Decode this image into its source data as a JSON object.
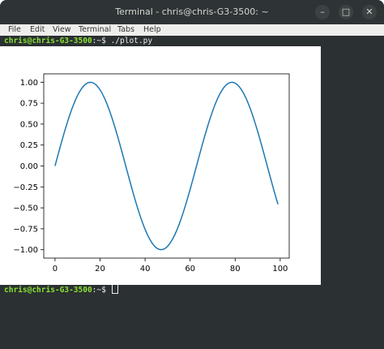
{
  "window": {
    "title": "Terminal - chris@chris-G3-3500: ~"
  },
  "menu": [
    "File",
    "Edit",
    "View",
    "Terminal",
    "Tabs",
    "Help"
  ],
  "terminal": {
    "prompt_user": "chris@chris-G3-3500",
    "prompt_suffix": ":~$ ",
    "command": "./plot.py"
  },
  "colors": {
    "line": "#1f77b4",
    "prompt": "#8ae234",
    "terminal_bg": "#2b3032"
  },
  "chart_data": {
    "type": "line",
    "x_ticks": [
      "0",
      "20",
      "40",
      "60",
      "80",
      "100"
    ],
    "y_ticks": [
      "1.00",
      "0.75",
      "0.50",
      "0.25",
      "0.00",
      "−0.25",
      "−0.50",
      "−0.75",
      "−1.00"
    ],
    "xlim": [
      -5,
      104
    ],
    "ylim": [
      -1.1,
      1.1
    ],
    "series": [
      {
        "values_expression": "y = sin(0.1 * x), x = 0..99",
        "x": [
          0,
          5,
          10,
          15,
          20,
          25,
          30,
          35,
          40,
          45,
          50,
          55,
          60,
          65,
          70,
          75,
          80,
          85,
          90,
          95,
          99
        ],
        "y": [
          0.0,
          0.479,
          0.841,
          0.997,
          0.909,
          0.598,
          0.141,
          -0.351,
          -0.757,
          -0.978,
          -0.959,
          -0.706,
          -0.279,
          0.215,
          0.657,
          0.938,
          0.989,
          0.798,
          0.412,
          -0.075,
          -0.457
        ]
      }
    ]
  }
}
